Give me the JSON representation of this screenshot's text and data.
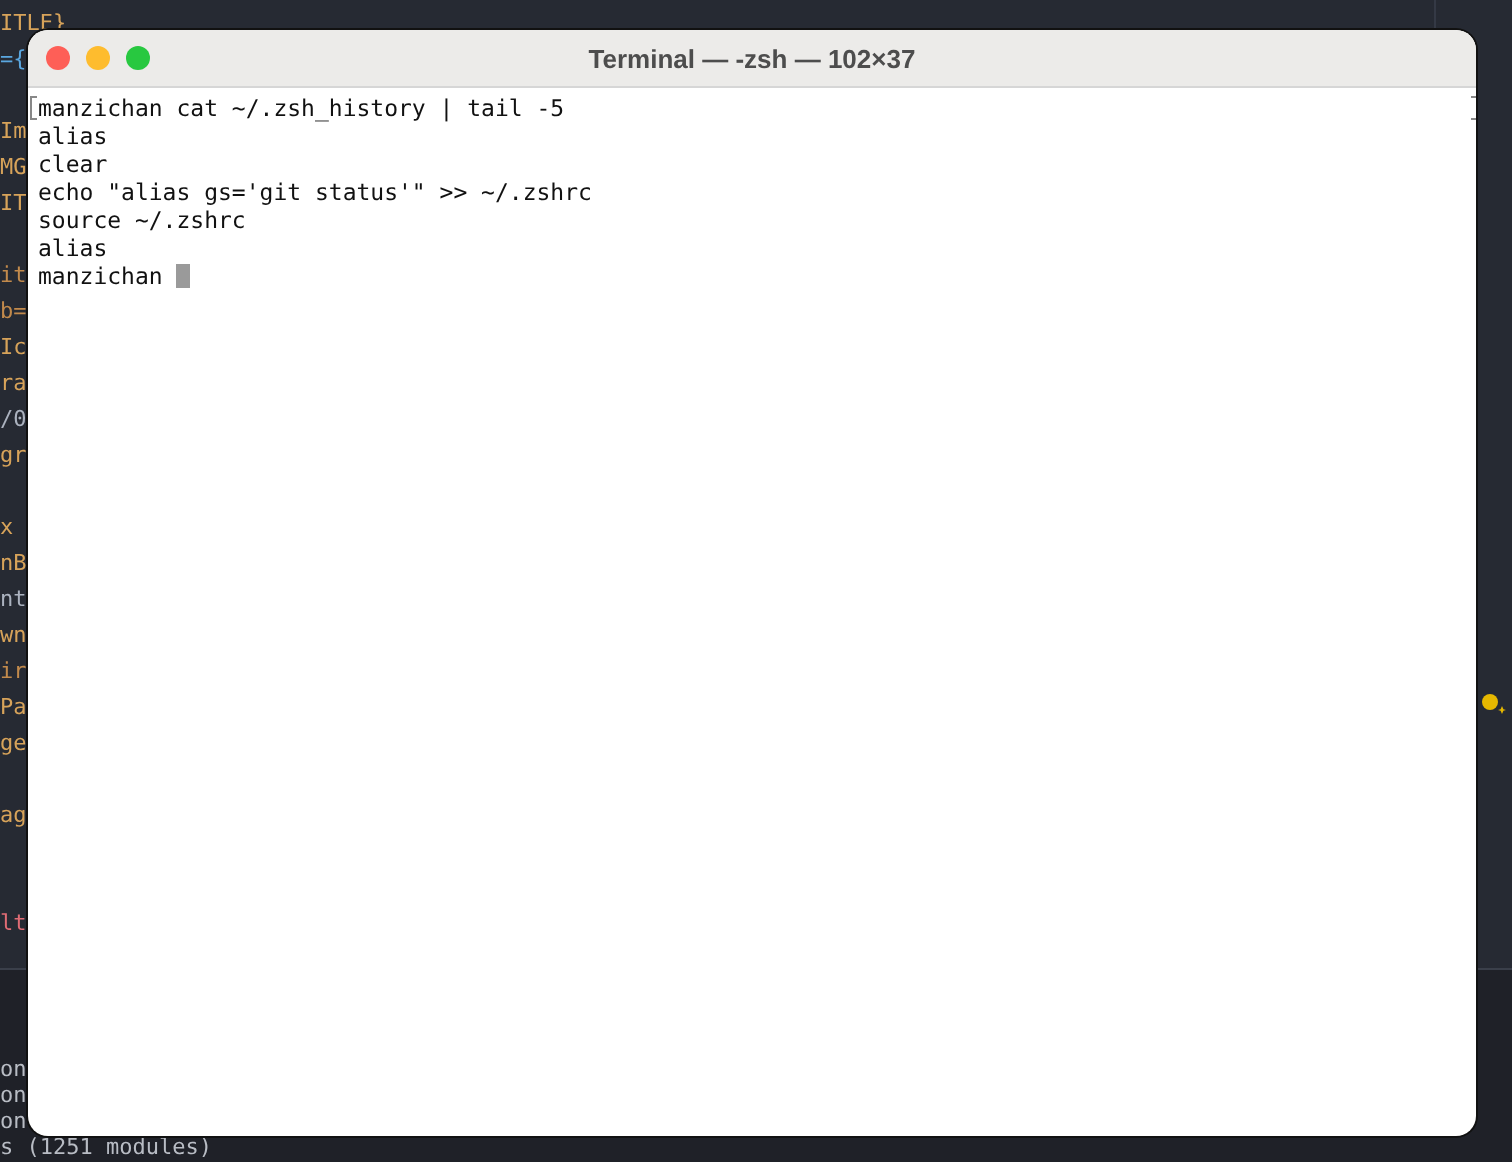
{
  "editor": {
    "code_blocks": [
      [
        {
          "text": "ITLE}",
          "color": "#d7a35a"
        },
        {
          "text": "={",
          "color": "#5aa7e0"
        }
      ],
      [
        {
          "text": "Im",
          "color": "#d7a35a"
        },
        {
          "text": "MG",
          "color": "#d7a35a"
        },
        {
          "text": "IT",
          "color": "#d7a35a"
        }
      ],
      [
        {
          "text": "it",
          "color": "#c28a4c"
        },
        {
          "text": "b=",
          "color": "#c28a4c"
        },
        {
          "text": "Ic",
          "color": "#d7a35a"
        },
        {
          "text": "ra",
          "color": "#d7a35a"
        },
        {
          "text": "/0",
          "color": "#abb2bf"
        },
        {
          "text": "gr",
          "color": "#d7a35a"
        }
      ],
      [
        {
          "text": "x",
          "color": "#d7a35a"
        },
        {
          "text": "nB",
          "color": "#d7a35a"
        },
        {
          "text": "nt",
          "color": "#abb2bf"
        },
        {
          "text": "wn",
          "color": "#d7a35a"
        },
        {
          "text": "ir",
          "color": "#c28a4c"
        },
        {
          "text": "Pa",
          "color": "#d7a35a"
        },
        {
          "text": "ge",
          "color": "#d7a35a"
        }
      ],
      [
        {
          "text": "ag",
          "color": "#d7a35a"
        }
      ],
      [
        {
          "text": "lt",
          "color": "#e06c75"
        }
      ]
    ],
    "output_lines": [
      "on",
      "on",
      "on",
      "s (1251 modules)"
    ]
  },
  "terminal": {
    "title": "Terminal — -zsh — 102×37",
    "lines": [
      {
        "text": "manzichan cat ~/.zsh_history | tail -5",
        "marked": true
      },
      {
        "text": "alias",
        "marked": false
      },
      {
        "text": "clear",
        "marked": false
      },
      {
        "text": "echo \"alias gs='git status'\" >> ~/.zshrc",
        "marked": false
      },
      {
        "text": "source ~/.zshrc",
        "marked": false
      },
      {
        "text": "alias",
        "marked": false
      },
      {
        "text": "manzichan",
        "marked": false,
        "cursor": true
      }
    ]
  }
}
